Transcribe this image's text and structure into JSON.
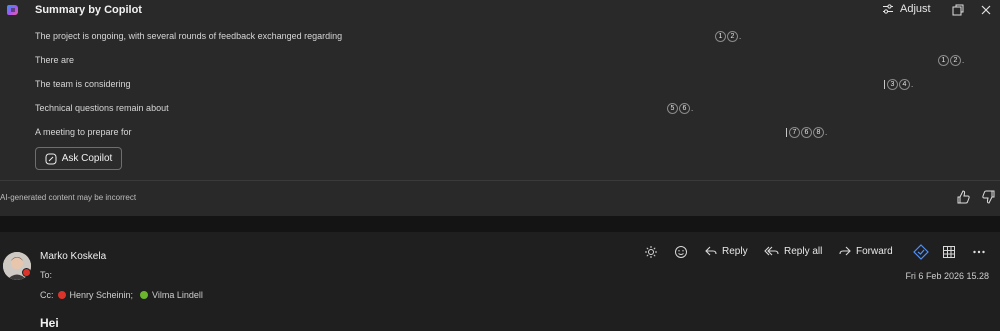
{
  "summary": {
    "title": "Summary by Copilot",
    "adjust_label": "Adjust",
    "lines": [
      {
        "text": "The                        project is ongoing, with several rounds of feedback exchanged regarding",
        "refs": [
          "1",
          "2"
        ],
        "bar": false
      },
      {
        "text": "There are",
        "refs": [
          "1",
          "2"
        ],
        "bar": false
      },
      {
        "text": "The team is considering",
        "refs": [
          "3",
          "4"
        ],
        "bar": true
      },
      {
        "text": "Technical questions remain about",
        "refs": [
          "5",
          "6"
        ],
        "bar": false
      },
      {
        "text": "A meeting to prepare for",
        "refs": [
          "7",
          "6",
          "8"
        ],
        "bar": true
      }
    ],
    "ask_label": "Ask Copilot",
    "disclaimer": "AI-generated content may be incorrect"
  },
  "email": {
    "sender": "Marko Koskela",
    "to_label": "To:",
    "cc_label": "Cc:",
    "cc": [
      {
        "name": "Henry Scheinin;",
        "status_color": "#d9342b"
      },
      {
        "name": "Vilma Lindell",
        "status_color": "#6bb52d"
      }
    ],
    "date": "Fri 6 Feb 2026 15.28",
    "greeting": "Hei",
    "toolbar": {
      "reply_label": "Reply",
      "reply_all_label": "Reply all",
      "forward_label": "Forward"
    }
  },
  "colors": {
    "accent": "#4f8ff7",
    "busy": "#d9342b",
    "available": "#6bb52d"
  }
}
